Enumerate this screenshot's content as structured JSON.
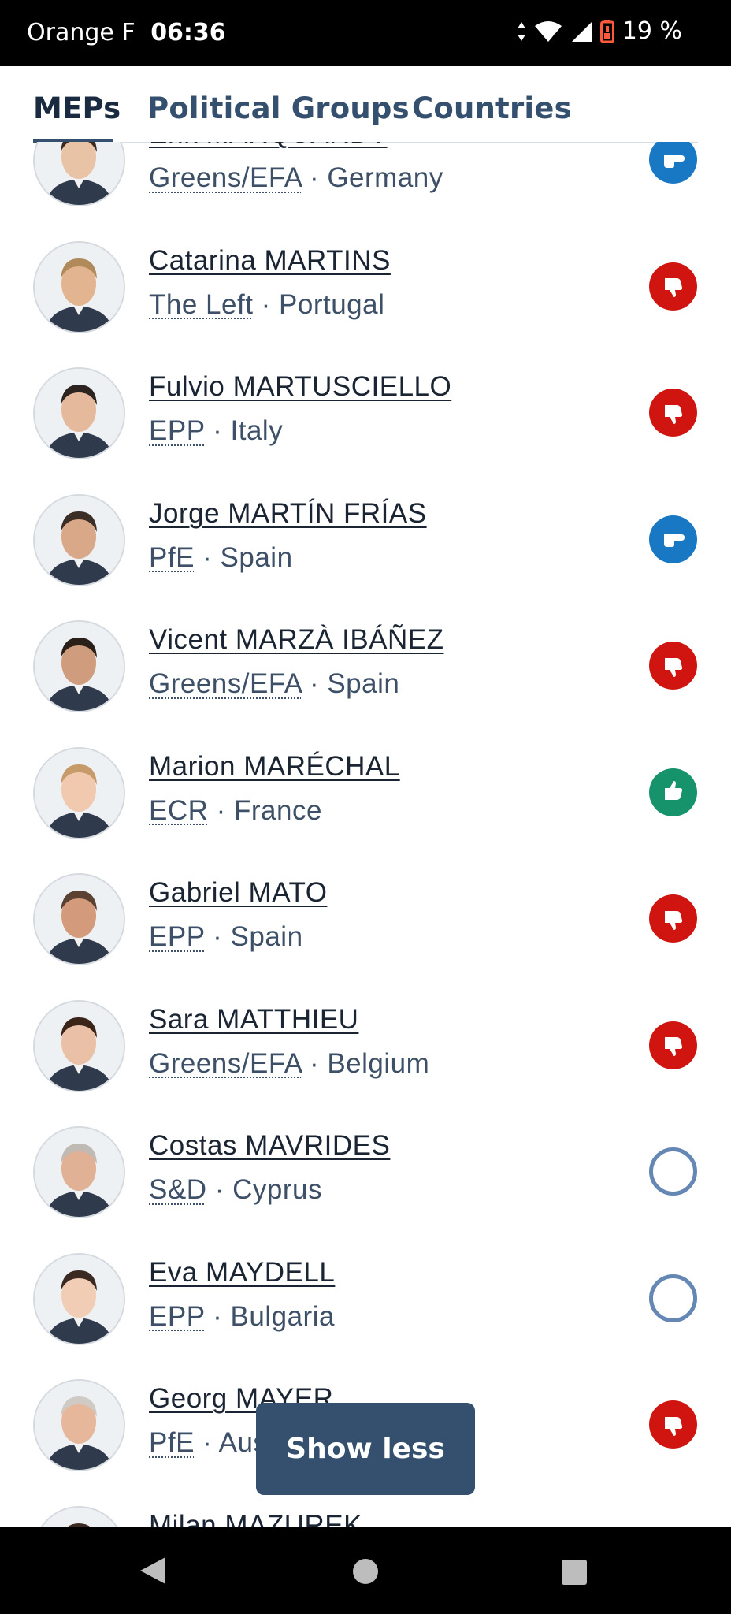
{
  "status": {
    "carrier": "Orange F",
    "time": "06:36",
    "battery": "19 %"
  },
  "tabs": [
    {
      "label": "MEPs",
      "active": true
    },
    {
      "label": "Political Groups",
      "active": false
    },
    {
      "label": "Countries",
      "active": false
    }
  ],
  "meps": [
    {
      "name": "Erik MARQUARDT",
      "group": "Greens/EFA",
      "country": "Germany",
      "vote": "abstain",
      "skin": "#e8c3a6",
      "hair": "#3a2a20"
    },
    {
      "name": "Catarina MARTINS",
      "group": "The Left",
      "country": "Portugal",
      "vote": "against",
      "skin": "#e2b48f",
      "hair": "#b08a5a"
    },
    {
      "name": "Fulvio MARTUSCIELLO",
      "group": "EPP",
      "country": "Italy",
      "vote": "against",
      "skin": "#e5b99b",
      "hair": "#2b2420"
    },
    {
      "name": "Jorge MARTÍN FRÍAS",
      "group": "PfE",
      "country": "Spain",
      "vote": "abstain",
      "skin": "#d9a889",
      "hair": "#3b2e26"
    },
    {
      "name": "Vicent MARZÀ IBÁÑEZ",
      "group": "Greens/EFA",
      "country": "Spain",
      "vote": "against",
      "skin": "#cf9d7e",
      "hair": "#2a1f19"
    },
    {
      "name": "Marion MARÉCHAL",
      "group": "ECR",
      "country": "France",
      "vote": "for",
      "skin": "#f0c9ae",
      "hair": "#c79a6a"
    },
    {
      "name": "Gabriel MATO",
      "group": "EPP",
      "country": "Spain",
      "vote": "against",
      "skin": "#d49a7c",
      "hair": "#5a4132"
    },
    {
      "name": "Sara MATTHIEU",
      "group": "Greens/EFA",
      "country": "Belgium",
      "vote": "against",
      "skin": "#eac0a6",
      "hair": "#3b2418"
    },
    {
      "name": "Costas MAVRIDES",
      "group": "S&D",
      "country": "Cyprus",
      "vote": "none",
      "skin": "#e0b195",
      "hair": "#bfbab4"
    },
    {
      "name": "Eva MAYDELL",
      "group": "EPP",
      "country": "Bulgaria",
      "vote": "none",
      "skin": "#f1cdb5",
      "hair": "#3a2a22"
    },
    {
      "name": "Georg MAYER",
      "group": "PfE",
      "country": "Austria",
      "vote": "against",
      "skin": "#e6b79b",
      "hair": "#cfcac4"
    },
    {
      "name": "Milan MAZUREK",
      "group": "",
      "country": "",
      "vote": "none",
      "skin": "#e0b195",
      "hair": "#3a2a22"
    }
  ],
  "show_less_label": "Show less",
  "colors": {
    "against": "#d0140f",
    "for": "#17936c",
    "abstain": "#1878c4",
    "none_outline": "#6487b3",
    "accent": "#34506e"
  }
}
